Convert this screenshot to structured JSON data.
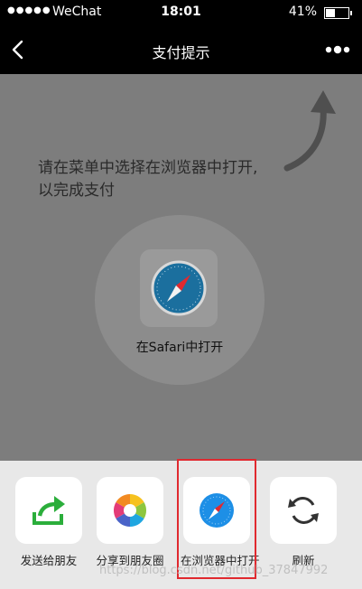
{
  "status": {
    "signal": "●●●●●",
    "carrier": "WeChat",
    "time": "18:01",
    "battery": "41%",
    "battery_level": 0.41
  },
  "nav": {
    "title": "支付提示",
    "back_icon": "chevron-left-icon",
    "more_icon": "more-dots-icon"
  },
  "overlay": {
    "hint_line1": "请在菜单中选择在浏览器中打开,",
    "hint_line2": "以完成支付",
    "circle_label": "在Safari中打开",
    "arrow_icon": "curved-arrow-icon"
  },
  "actions": [
    {
      "label": "发送给朋友",
      "icon": "share-arrow-icon"
    },
    {
      "label": "分享到朋友圈",
      "icon": "moments-aperture-icon"
    },
    {
      "label": "在浏览器中打开",
      "icon": "safari-compass-icon"
    },
    {
      "label": "刷新",
      "icon": "refresh-icon"
    }
  ],
  "watermark": "https://blog.csdn.net/github_37847992",
  "colors": {
    "highlight": "#e0292f",
    "share_green": "#2bae3b",
    "safari_blue": "#1d8fe6"
  }
}
